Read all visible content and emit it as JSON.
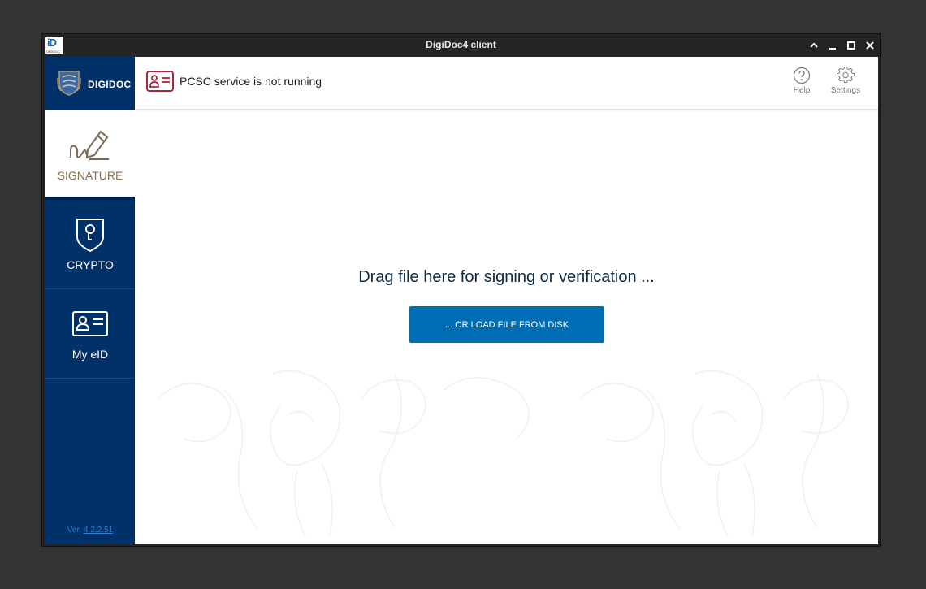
{
  "window": {
    "title": "DigiDoc4 client",
    "app_icon_text": "iD",
    "app_icon_sub": "DIGIDOC"
  },
  "sidebar": {
    "logo_text": "DIGIDOC",
    "items": [
      {
        "label": "SIGNATURE",
        "icon": "signature-icon",
        "active": true
      },
      {
        "label": "CRYPTO",
        "icon": "shield-lock-icon",
        "active": false
      },
      {
        "label": "My eID",
        "icon": "id-card-icon",
        "active": false
      }
    ],
    "version_prefix": "Ver.",
    "version_number": "4.2.2.51"
  },
  "header": {
    "status_text": "PCSC service is not running",
    "status_icon": "id-card-icon",
    "help_label": "Help",
    "settings_label": "Settings"
  },
  "main": {
    "drop_text": "Drag file here for signing or verification ...",
    "load_button_label": "... OR LOAD FILE FROM DISK"
  },
  "colors": {
    "sidebar_bg": "#003168",
    "active_label": "#8a7248",
    "status_icon": "#a6283c",
    "button_bg": "#006eb5",
    "version_link": "#2a7fd4"
  }
}
